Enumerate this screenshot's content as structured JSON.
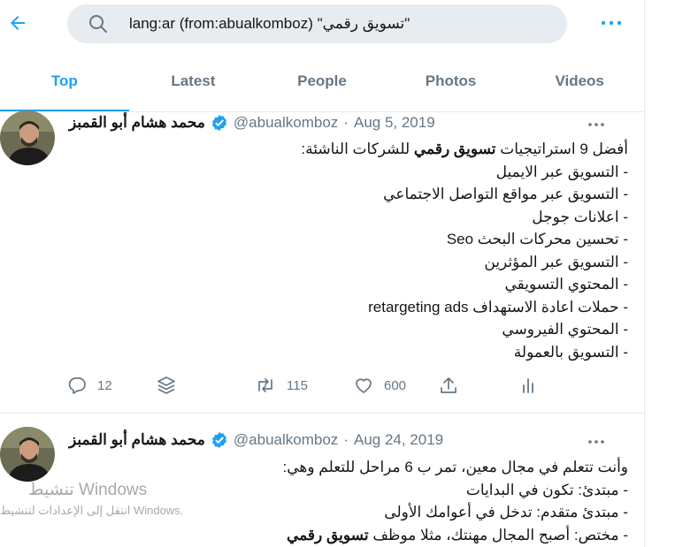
{
  "header": {
    "search_value": "lang:ar (from:abualkomboz) \"تسويق رقمي\""
  },
  "tabs": [
    {
      "label": "Top",
      "active": true
    },
    {
      "label": "Latest",
      "active": false
    },
    {
      "label": "People",
      "active": false
    },
    {
      "label": "Photos",
      "active": false
    },
    {
      "label": "Videos",
      "active": false
    }
  ],
  "tweets": [
    {
      "name": "محمد هشام أبو القمبز",
      "handle": "@abualkomboz",
      "separator": "·",
      "date": "Aug 5, 2019",
      "lines": [
        {
          "pre": "أفضل 9 استراتيجيات ",
          "bold": "تسويق رقمي",
          "post": " للشركات الناشئة:"
        },
        {
          "text": "- التسويق عبر الايميل"
        },
        {
          "text": "- التسويق عبر مواقع التواصل الاجتماعي"
        },
        {
          "text": "- اعلانات جوجل"
        },
        {
          "text": "- تحسين محركات البحث Seo"
        },
        {
          "text": "- التسويق عبر المؤثرين"
        },
        {
          "text": "- المحتوي التسويقي"
        },
        {
          "text": "- حملات اعادة الاستهداف retargeting ads"
        },
        {
          "text": "- المحتوي الفيروسي"
        },
        {
          "text": "- التسويق بالعمولة"
        }
      ],
      "replies": "12",
      "retweets": "115",
      "likes": "600"
    },
    {
      "name": "محمد هشام أبو القمبز",
      "handle": "@abualkomboz",
      "separator": "·",
      "date": "Aug 24, 2019",
      "lines": [
        {
          "text": "وأنت تتعلم في مجال معين، تمر ب 6 مراحل للتعلم وهي:"
        },
        {
          "text": "- مبتدئ: تكون في البدايات"
        },
        {
          "text": "- مبتدئ متقدم: تدخل في أعوامك الأولى"
        },
        {
          "pre": "- مختص: أصبح المجال مهنتك، مثلا موظف ",
          "bold": "تسويق رقمي",
          "post": ""
        }
      ]
    }
  ],
  "watermark": {
    "line1": "تنشيط Windows",
    "line2": "انتقل إلى الإعدادات لتنشيط Windows."
  },
  "colors": {
    "accent": "#1da1f2",
    "secondary_text": "#657786",
    "border": "#e6ecf0",
    "search_bg": "#e6ecf0"
  }
}
